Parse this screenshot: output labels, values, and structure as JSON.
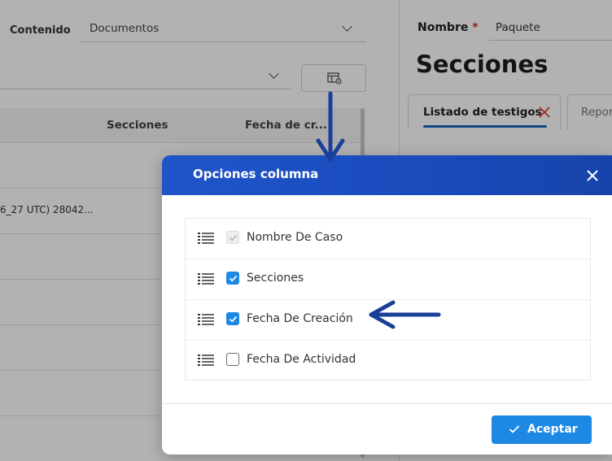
{
  "contenido": {
    "label": "Contenido",
    "value": "Documentos"
  },
  "table": {
    "headers": [
      "Secciones",
      "Fecha de cr..."
    ],
    "row_text": "6_27 UTC) 28042..."
  },
  "form": {
    "nombre_label": "Nombre",
    "required_mark": "*",
    "nombre_value": "Paquete",
    "section_title": "Secciones",
    "tabs": [
      {
        "label": "Listado de testigos",
        "active": true
      },
      {
        "label": "Repor",
        "active": false
      }
    ]
  },
  "modal": {
    "title": "Opciones columna",
    "options": [
      {
        "label": "Nombre De Caso",
        "state": "checked-disabled"
      },
      {
        "label": "Secciones",
        "state": "checked"
      },
      {
        "label": "Fecha De Creación",
        "state": "checked"
      },
      {
        "label": "Fecha De Actividad",
        "state": "unchecked"
      }
    ],
    "accept_label": "Aceptar"
  },
  "colors": {
    "header_blue": "#1f55c8",
    "checkbox_blue": "#1e88e5",
    "annotation_arrow": "#1a3f98",
    "tab_underline": "#1565c0",
    "close_red": "#e53935"
  },
  "icons": {
    "column_settings": "column-settings-icon",
    "close": "close-icon",
    "drag": "drag-handle-icon",
    "check": "checkmark-icon"
  }
}
